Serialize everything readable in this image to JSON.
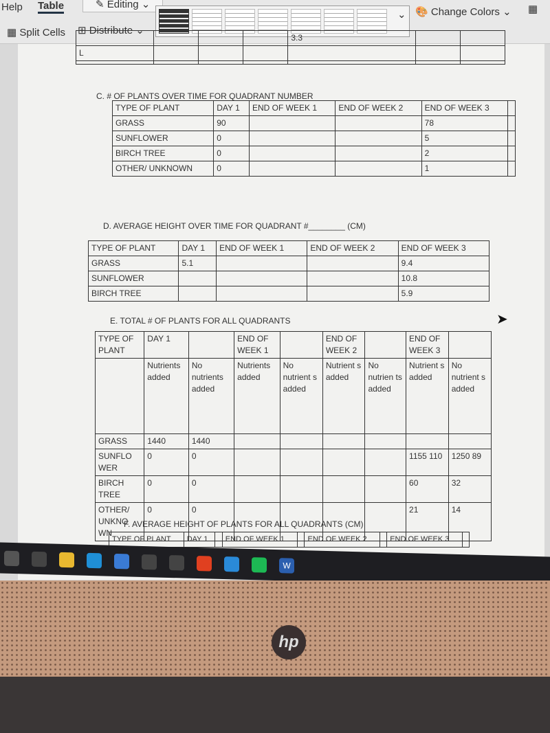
{
  "ribbon": {
    "tabs": [
      "Help",
      "Table"
    ],
    "editing": "Editing",
    "split_cells": "Split Cells",
    "distribute": "Distribute",
    "change_colors": "Change Colors"
  },
  "top_table": {
    "rows": [
      [
        "",
        "",
        "",
        "",
        "3.3",
        "",
        ""
      ],
      [
        "L",
        "",
        "",
        "",
        "",
        "",
        ""
      ],
      [
        "",
        "",
        "",
        "",
        "",
        "",
        ""
      ]
    ]
  },
  "section_c": {
    "title": "C.   # OF PLANTS OVER TIME FOR QUADRANT NUMBER",
    "rows": [
      [
        "TYPE OF PLANT",
        "DAY 1",
        "END OF WEEK 1",
        "END OF WEEK 2",
        "END OF WEEK 3",
        ""
      ],
      [
        "GRASS",
        "90",
        "",
        "",
        "78",
        ""
      ],
      [
        "SUNFLOWER",
        "0",
        "",
        "",
        "5",
        ""
      ],
      [
        "BIRCH TREE",
        "0",
        "",
        "",
        "2",
        ""
      ],
      [
        "OTHER/ UNKNOWN",
        "0",
        "",
        "",
        "1",
        ""
      ]
    ]
  },
  "section_d": {
    "title": "D.   AVERAGE HEIGHT OVER TIME FOR QUADRANT #________ (CM)",
    "rows": [
      [
        "TYPE OF PLANT",
        "DAY 1",
        "END OF WEEK 1",
        "END OF WEEK 2",
        "END OF WEEK 3"
      ],
      [
        "GRASS",
        "5.1",
        "",
        "",
        "9.4"
      ],
      [
        "SUNFLOWER",
        "",
        "",
        "",
        "10.8"
      ],
      [
        "BIRCH TREE",
        "",
        "",
        "",
        "5.9"
      ]
    ]
  },
  "section_e": {
    "title": "E.   TOTAL # OF PLANTS FOR ALL QUADRANTS",
    "rows": [
      [
        "TYPE OF PLANT",
        "DAY 1",
        "",
        "END OF WEEK 1",
        "",
        "END OF WEEK 2",
        "",
        "END OF WEEK 3",
        ""
      ],
      [
        "",
        "Nutrients added",
        "No nutrients added",
        "Nutrients added",
        "No nutrient s added",
        "Nutrient s added",
        "No nutrien ts added",
        "Nutrient s added",
        "No nutrient s added"
      ],
      [
        "GRASS",
        "1440",
        "1440",
        "",
        "",
        "",
        "",
        "",
        ""
      ],
      [
        "SUNFLO WER",
        "0",
        "0",
        "",
        "",
        "",
        "",
        "1155 110",
        "1250 89"
      ],
      [
        "BIRCH TREE",
        "0",
        "0",
        "",
        "",
        "",
        "",
        "60",
        "32"
      ],
      [
        "OTHER/ UNKNO WN",
        "0",
        "0",
        "",
        "",
        "",
        "",
        "21",
        "14"
      ]
    ]
  },
  "section_f": {
    "title": "F.   AVERAGE HEIGHT OF PLANTS FOR ALL QUADRANTS (CM)",
    "rows": [
      [
        "TYPE OF PLANT",
        "DAY 1",
        "",
        "END OF WEEK 1",
        "",
        "END OF WEEK 2",
        "",
        "END OF WEEK 3",
        ""
      ]
    ]
  },
  "taskbar": {
    "apps": [
      "search",
      "task-view",
      "file-explorer",
      "edge",
      "store",
      "dropbox",
      "app",
      "office",
      "mail",
      "spotify",
      "word"
    ],
    "word_label": "W"
  },
  "bezel": {
    "logo": "hp"
  }
}
